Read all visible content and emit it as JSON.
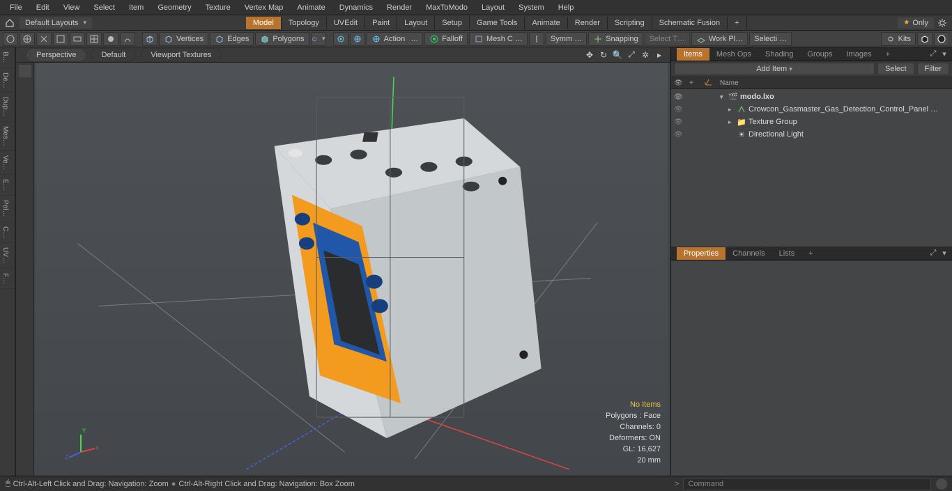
{
  "menu": {
    "items": [
      "File",
      "Edit",
      "View",
      "Select",
      "Item",
      "Geometry",
      "Texture",
      "Vertex Map",
      "Animate",
      "Dynamics",
      "Render",
      "MaxToModo",
      "Layout",
      "System",
      "Help"
    ]
  },
  "layout": {
    "dropdown": "Default Layouts",
    "tabs": [
      "Model",
      "Topology",
      "UVEdit",
      "Paint",
      "Layout",
      "Setup",
      "Game Tools",
      "Animate",
      "Render",
      "Scripting",
      "Schematic Fusion"
    ],
    "active_tab": "Model",
    "only": "Only"
  },
  "ribbon": {
    "vertices": "Vertices",
    "edges": "Edges",
    "polygons": "Polygons",
    "action": "Action",
    "action_ell": "…",
    "falloff": "Falloff",
    "meshc": "Mesh C …",
    "symm": "Symm …",
    "snapping": "Snapping",
    "selectt": "Select T…",
    "workpl": "Work Pl…",
    "selecti": "Selecti …",
    "kits": "Kits"
  },
  "left_tabs": [
    "B…",
    "De…",
    "Dup…",
    "Mes…",
    "Ve…",
    "E…",
    "Pol…",
    "C…",
    "UV…",
    "F…"
  ],
  "viewport": {
    "tabs": [
      "Perspective",
      "Default",
      "Viewport Textures"
    ],
    "stats": {
      "no_items": "No Items",
      "polygons": "Polygons : Face",
      "channels": "Channels: 0",
      "deformers": "Deformers: ON",
      "gl": "GL: 16,627",
      "unit": "20 mm"
    }
  },
  "items_panel": {
    "tabs": [
      "Items",
      "Mesh Ops",
      "Shading",
      "Groups",
      "Images"
    ],
    "active": "Items",
    "add": "Add Item",
    "select": "Select",
    "filter": "Filter",
    "name_col": "Name",
    "tree": {
      "root": "modo.lxo",
      "mesh": "Crowcon_Gasmaster_Gas_Detection_Control_Panel …",
      "texture": "Texture Group",
      "light": "Directional Light"
    }
  },
  "props_panel": {
    "tabs": [
      "Properties",
      "Channels",
      "Lists"
    ],
    "active": "Properties"
  },
  "status": {
    "hint1": "Ctrl-Alt-Left Click and Drag: Navigation: Zoom",
    "hint2": "Ctrl-Alt-Right Click and Drag: Navigation: Box Zoom",
    "cmd_placeholder": "Command"
  }
}
